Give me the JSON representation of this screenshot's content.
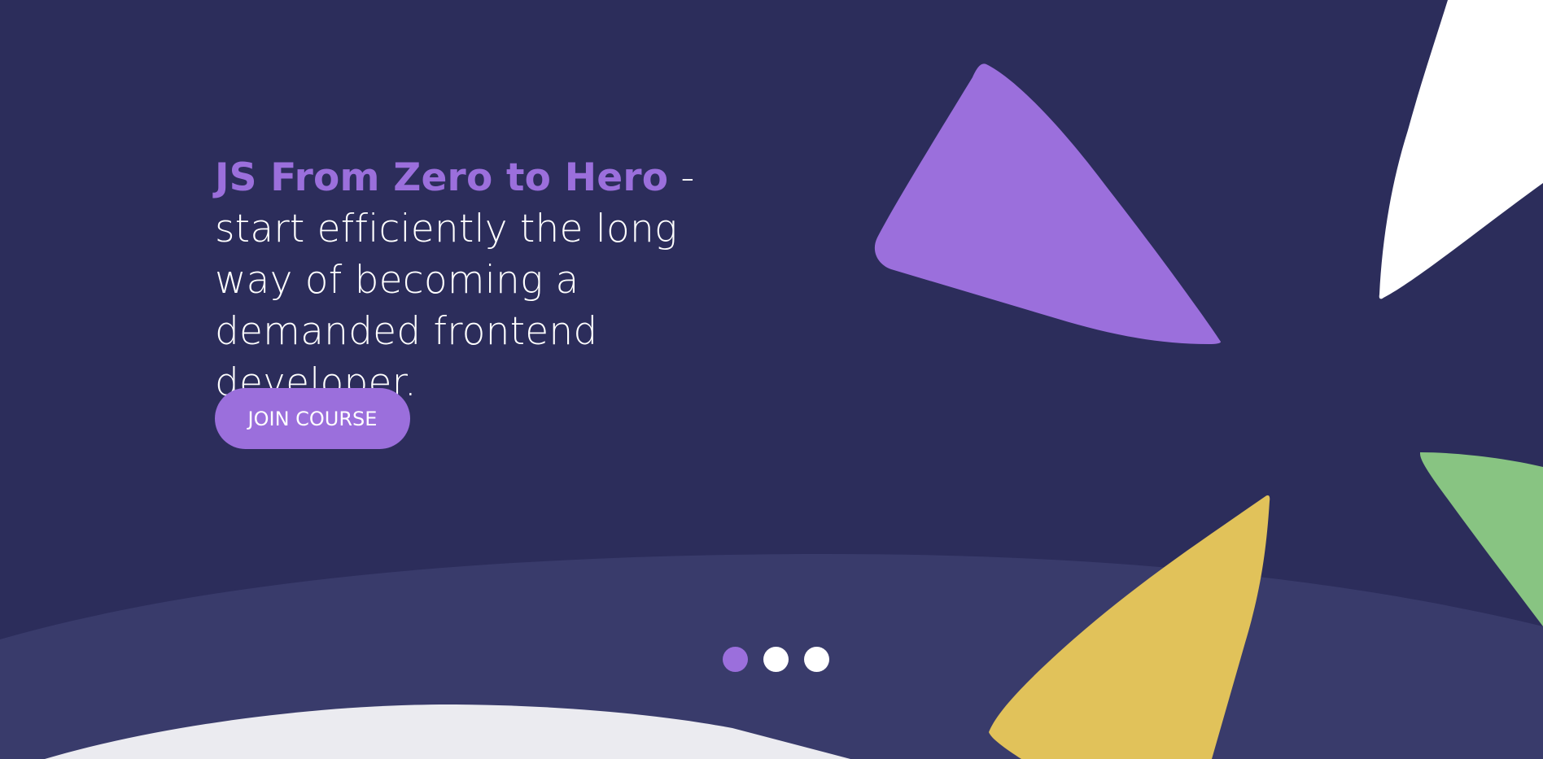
{
  "hero": {
    "headline_accent": "JS From Zero to Hero",
    "headline_rest": " - start efficiently the long way of becoming a demanded frontend developer.",
    "button_label": "JOIN COURSE"
  },
  "slider": {
    "active_index": 0,
    "dots": [
      "slide-1",
      "slide-2",
      "slide-3"
    ]
  },
  "colors": {
    "background": "#2c2d5b",
    "band": "#393b6b",
    "accent_purple": "#9b6fdc",
    "shape_yellow": "#e1c25a",
    "shape_green": "#88c482",
    "shape_white": "#ffffff",
    "bottom_surface": "#ebebf0"
  }
}
